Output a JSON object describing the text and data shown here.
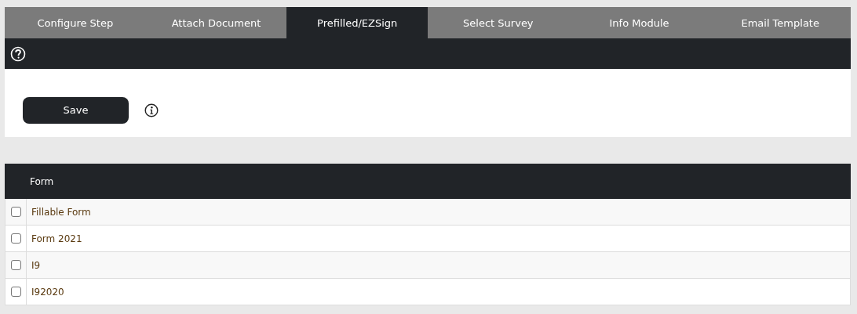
{
  "tabs": [
    {
      "label": "Configure Step",
      "selected": false
    },
    {
      "label": "Attach Document",
      "selected": false
    },
    {
      "label": "Prefilled/EZSign",
      "selected": true
    },
    {
      "label": "Select Survey",
      "selected": false
    },
    {
      "label": "Info Module",
      "selected": false
    },
    {
      "label": "Email Template",
      "selected": false
    }
  ],
  "save_button": {
    "label": "Save"
  },
  "table": {
    "columns": [
      "Form"
    ],
    "rows": [
      {
        "name": "Fillable Form",
        "checked": false
      },
      {
        "name": "Form 2021",
        "checked": false
      },
      {
        "name": "I9",
        "checked": false
      },
      {
        "name": "I92020",
        "checked": false
      }
    ]
  }
}
